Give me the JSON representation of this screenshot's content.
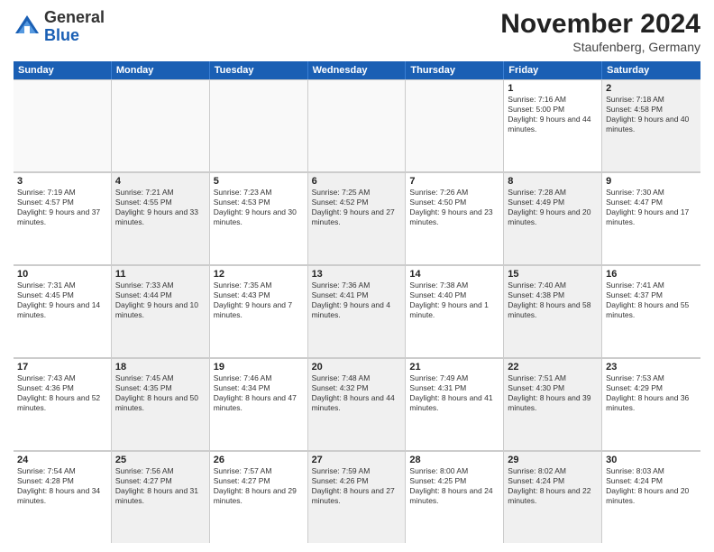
{
  "logo": {
    "general": "General",
    "blue": "Blue"
  },
  "header": {
    "title": "November 2024",
    "subtitle": "Staufenberg, Germany"
  },
  "weekdays": [
    "Sunday",
    "Monday",
    "Tuesday",
    "Wednesday",
    "Thursday",
    "Friday",
    "Saturday"
  ],
  "weeks": [
    [
      {
        "day": "",
        "info": "",
        "shaded": true
      },
      {
        "day": "",
        "info": "",
        "shaded": true
      },
      {
        "day": "",
        "info": "",
        "shaded": true
      },
      {
        "day": "",
        "info": "",
        "shaded": true
      },
      {
        "day": "",
        "info": "",
        "shaded": true
      },
      {
        "day": "1",
        "info": "Sunrise: 7:16 AM\nSunset: 5:00 PM\nDaylight: 9 hours and 44 minutes.",
        "shaded": false
      },
      {
        "day": "2",
        "info": "Sunrise: 7:18 AM\nSunset: 4:58 PM\nDaylight: 9 hours and 40 minutes.",
        "shaded": true
      }
    ],
    [
      {
        "day": "3",
        "info": "Sunrise: 7:19 AM\nSunset: 4:57 PM\nDaylight: 9 hours and 37 minutes.",
        "shaded": false
      },
      {
        "day": "4",
        "info": "Sunrise: 7:21 AM\nSunset: 4:55 PM\nDaylight: 9 hours and 33 minutes.",
        "shaded": true
      },
      {
        "day": "5",
        "info": "Sunrise: 7:23 AM\nSunset: 4:53 PM\nDaylight: 9 hours and 30 minutes.",
        "shaded": false
      },
      {
        "day": "6",
        "info": "Sunrise: 7:25 AM\nSunset: 4:52 PM\nDaylight: 9 hours and 27 minutes.",
        "shaded": true
      },
      {
        "day": "7",
        "info": "Sunrise: 7:26 AM\nSunset: 4:50 PM\nDaylight: 9 hours and 23 minutes.",
        "shaded": false
      },
      {
        "day": "8",
        "info": "Sunrise: 7:28 AM\nSunset: 4:49 PM\nDaylight: 9 hours and 20 minutes.",
        "shaded": true
      },
      {
        "day": "9",
        "info": "Sunrise: 7:30 AM\nSunset: 4:47 PM\nDaylight: 9 hours and 17 minutes.",
        "shaded": false
      }
    ],
    [
      {
        "day": "10",
        "info": "Sunrise: 7:31 AM\nSunset: 4:45 PM\nDaylight: 9 hours and 14 minutes.",
        "shaded": false
      },
      {
        "day": "11",
        "info": "Sunrise: 7:33 AM\nSunset: 4:44 PM\nDaylight: 9 hours and 10 minutes.",
        "shaded": true
      },
      {
        "day": "12",
        "info": "Sunrise: 7:35 AM\nSunset: 4:43 PM\nDaylight: 9 hours and 7 minutes.",
        "shaded": false
      },
      {
        "day": "13",
        "info": "Sunrise: 7:36 AM\nSunset: 4:41 PM\nDaylight: 9 hours and 4 minutes.",
        "shaded": true
      },
      {
        "day": "14",
        "info": "Sunrise: 7:38 AM\nSunset: 4:40 PM\nDaylight: 9 hours and 1 minute.",
        "shaded": false
      },
      {
        "day": "15",
        "info": "Sunrise: 7:40 AM\nSunset: 4:38 PM\nDaylight: 8 hours and 58 minutes.",
        "shaded": true
      },
      {
        "day": "16",
        "info": "Sunrise: 7:41 AM\nSunset: 4:37 PM\nDaylight: 8 hours and 55 minutes.",
        "shaded": false
      }
    ],
    [
      {
        "day": "17",
        "info": "Sunrise: 7:43 AM\nSunset: 4:36 PM\nDaylight: 8 hours and 52 minutes.",
        "shaded": false
      },
      {
        "day": "18",
        "info": "Sunrise: 7:45 AM\nSunset: 4:35 PM\nDaylight: 8 hours and 50 minutes.",
        "shaded": true
      },
      {
        "day": "19",
        "info": "Sunrise: 7:46 AM\nSunset: 4:34 PM\nDaylight: 8 hours and 47 minutes.",
        "shaded": false
      },
      {
        "day": "20",
        "info": "Sunrise: 7:48 AM\nSunset: 4:32 PM\nDaylight: 8 hours and 44 minutes.",
        "shaded": true
      },
      {
        "day": "21",
        "info": "Sunrise: 7:49 AM\nSunset: 4:31 PM\nDaylight: 8 hours and 41 minutes.",
        "shaded": false
      },
      {
        "day": "22",
        "info": "Sunrise: 7:51 AM\nSunset: 4:30 PM\nDaylight: 8 hours and 39 minutes.",
        "shaded": true
      },
      {
        "day": "23",
        "info": "Sunrise: 7:53 AM\nSunset: 4:29 PM\nDaylight: 8 hours and 36 minutes.",
        "shaded": false
      }
    ],
    [
      {
        "day": "24",
        "info": "Sunrise: 7:54 AM\nSunset: 4:28 PM\nDaylight: 8 hours and 34 minutes.",
        "shaded": false
      },
      {
        "day": "25",
        "info": "Sunrise: 7:56 AM\nSunset: 4:27 PM\nDaylight: 8 hours and 31 minutes.",
        "shaded": true
      },
      {
        "day": "26",
        "info": "Sunrise: 7:57 AM\nSunset: 4:27 PM\nDaylight: 8 hours and 29 minutes.",
        "shaded": false
      },
      {
        "day": "27",
        "info": "Sunrise: 7:59 AM\nSunset: 4:26 PM\nDaylight: 8 hours and 27 minutes.",
        "shaded": true
      },
      {
        "day": "28",
        "info": "Sunrise: 8:00 AM\nSunset: 4:25 PM\nDaylight: 8 hours and 24 minutes.",
        "shaded": false
      },
      {
        "day": "29",
        "info": "Sunrise: 8:02 AM\nSunset: 4:24 PM\nDaylight: 8 hours and 22 minutes.",
        "shaded": true
      },
      {
        "day": "30",
        "info": "Sunrise: 8:03 AM\nSunset: 4:24 PM\nDaylight: 8 hours and 20 minutes.",
        "shaded": false
      }
    ]
  ]
}
